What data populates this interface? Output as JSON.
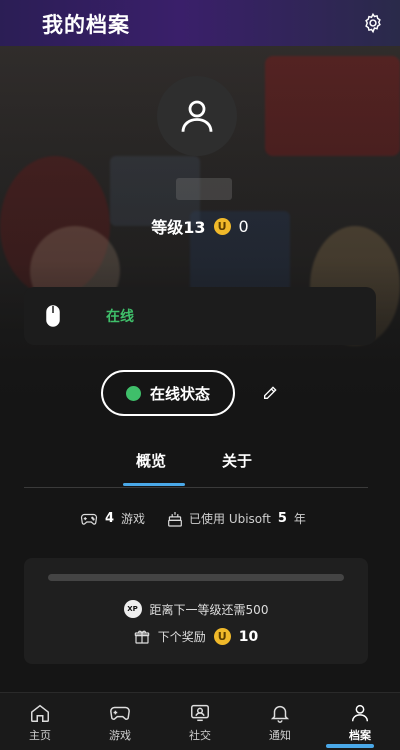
{
  "header": {
    "title": "我的档案",
    "settings_icon": "gear-icon"
  },
  "profile": {
    "avatar_icon": "user-icon",
    "level_label": "等级13",
    "coin_icon": "ubisoft-coin-icon",
    "coin_symbol": "U",
    "coins": "0"
  },
  "status_card": {
    "icon": "mouse-icon",
    "status": "在线",
    "status_color": "#3fbf6a"
  },
  "online_button": {
    "label": "在线状态",
    "edit_icon": "pencil-icon"
  },
  "tabs": [
    {
      "label": "概览",
      "active": true
    },
    {
      "label": "关于",
      "active": false
    }
  ],
  "stats": {
    "games_count": "4",
    "games_label": "游戏",
    "years_prefix": "已使用 Ubisoft",
    "years_count": "5",
    "years_suffix": "年"
  },
  "xp_card": {
    "xp_badge": "XP",
    "next_level_text": "距离下一等级还需500",
    "reward_label": "下个奖励",
    "reward_coin_symbol": "U",
    "reward_value": "10"
  },
  "bottom_nav": [
    {
      "label": "主页",
      "icon": "home-icon"
    },
    {
      "label": "游戏",
      "icon": "gamepad-icon"
    },
    {
      "label": "社交",
      "icon": "social-icon"
    },
    {
      "label": "通知",
      "icon": "bell-icon"
    },
    {
      "label": "档案",
      "icon": "profile-icon",
      "active": true
    }
  ],
  "colors": {
    "accent": "#4aa8e8",
    "online": "#3fbf6a",
    "coin": "#f0b92a"
  }
}
